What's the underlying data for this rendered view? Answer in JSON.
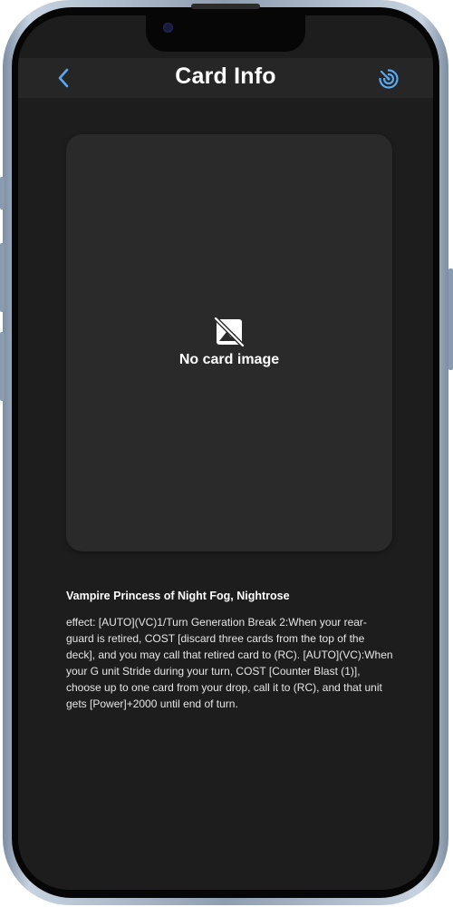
{
  "header": {
    "title": "Card Info",
    "back_icon": "chevron-left-icon",
    "action_icon": "radar-icon"
  },
  "card": {
    "image_placeholder_icon": "image-off-icon",
    "image_placeholder_text": "No card image",
    "name": "Vampire Princess of Night Fog, Nightrose",
    "effect": "effect: [AUTO](VC)1/Turn Generation Break 2:When your rear-guard is retired, COST [discard three cards from the top of the deck], and you may call that retired card to (RC). [AUTO](VC):When your G unit Stride during your turn, COST [Counter Blast (1)], choose up to one card from your drop, call it to (RC), and that unit gets [Power]+2000 until end of turn."
  },
  "colors": {
    "accent": "#5aa9f0",
    "screen_bg": "#1d1d1d",
    "header_bg": "#262626",
    "card_bg": "#2a2a2a"
  }
}
